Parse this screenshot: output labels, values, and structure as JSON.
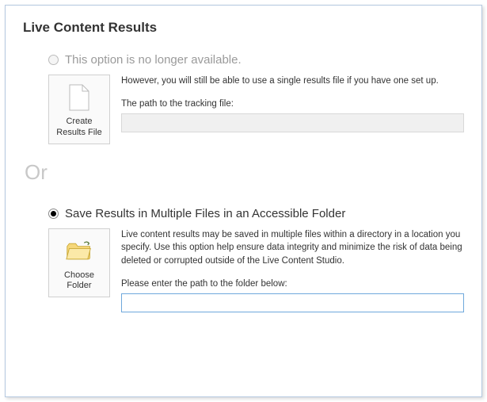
{
  "title": "Live Content Results",
  "divider": "Or",
  "option1": {
    "label": "This option is no longer available.",
    "description": "However, you will still be able to use a single results file if you have one set up.",
    "field_label": "The path to the tracking file:",
    "field_value": "",
    "button_label": "Create Results File"
  },
  "option2": {
    "label": "Save Results in Multiple Files in an Accessible Folder",
    "description": "Live content results may be saved in multiple files within a directory in a location you specify. Use this option help ensure data integrity and minimize the risk of data being deleted or corrupted outside of the Live Content Studio.",
    "field_label": "Please enter the path to the folder below:",
    "field_value": "",
    "button_label": "Choose Folder"
  }
}
